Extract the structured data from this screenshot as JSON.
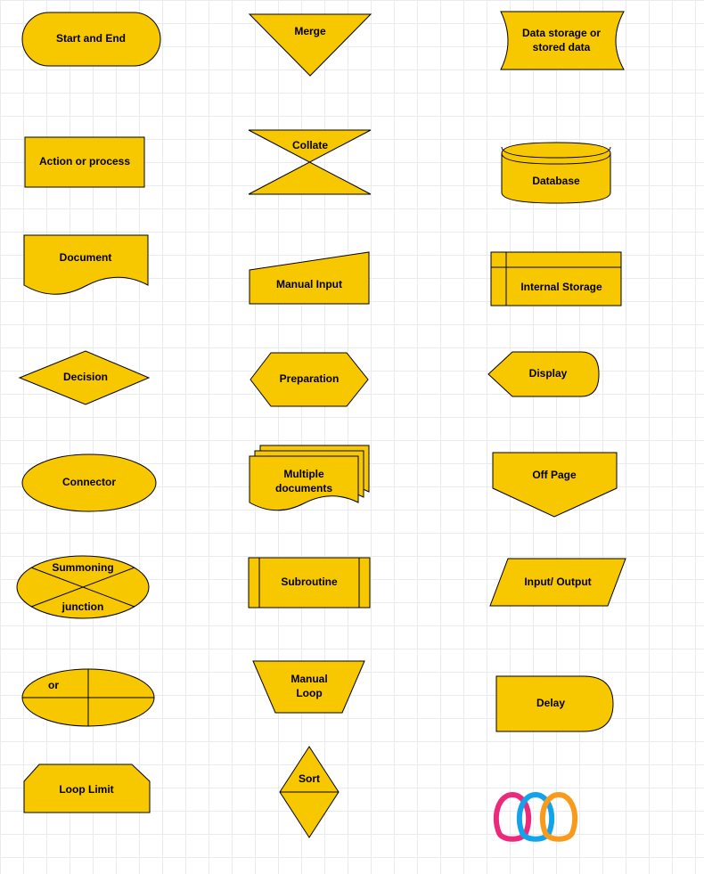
{
  "shapes": {
    "start_end": {
      "label": "Start and End"
    },
    "action_process": {
      "label": "Action or process"
    },
    "document": {
      "label": "Document"
    },
    "decision": {
      "label": "Decision"
    },
    "connector": {
      "label": "Connector"
    },
    "summoning": {
      "label_line1": "Summoning",
      "label_line2": "junction"
    },
    "or": {
      "label": "or"
    },
    "loop_limit": {
      "label": "Loop Limit"
    },
    "merge": {
      "label": "Merge"
    },
    "collate": {
      "label": "Collate"
    },
    "manual_input": {
      "label": "Manual Input"
    },
    "preparation": {
      "label": "Preparation"
    },
    "multiple_docs": {
      "label_line1": "Multiple",
      "label_line2": "documents"
    },
    "subroutine": {
      "label": "Subroutine"
    },
    "manual_loop": {
      "label_line1": "Manual",
      "label_line2": "Loop"
    },
    "sort": {
      "label": "Sort"
    },
    "data_storage": {
      "label_line1": "Data storage or",
      "label_line2": "stored data"
    },
    "database": {
      "label": "Database"
    },
    "internal_storage": {
      "label": "Internal Storage"
    },
    "display": {
      "label": "Display"
    },
    "off_page": {
      "label": "Off Page"
    },
    "input_output": {
      "label": "Input/ Output"
    },
    "delay": {
      "label": "Delay"
    }
  },
  "colors": {
    "fill": "#f7c700",
    "stroke": "#000000"
  }
}
